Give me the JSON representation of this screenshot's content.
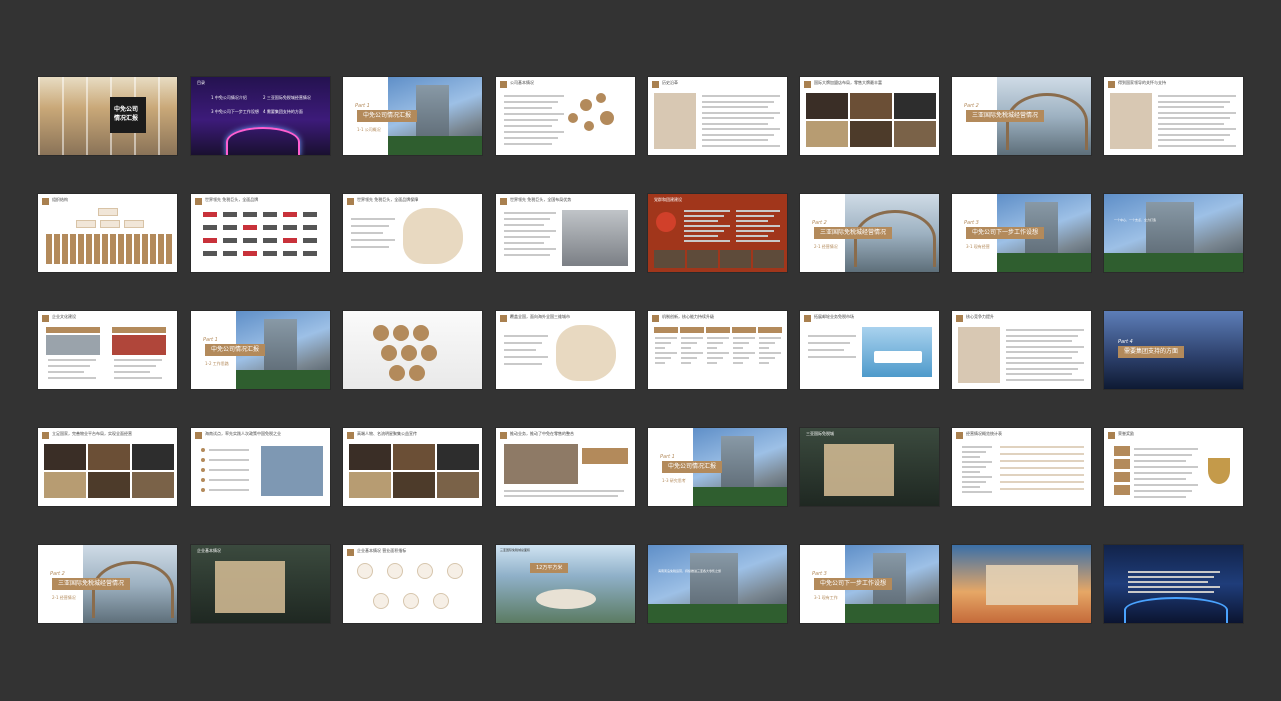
{
  "page": {
    "background": "#333333",
    "accent": "#b38a5b"
  },
  "slides": [
    {
      "kind": "cover",
      "title": "中免公司\n情况汇报"
    },
    {
      "kind": "toc",
      "header": "目录",
      "items": [
        "1  中免公司情况介绍",
        "2  三亚国际免税城经营情况",
        "3  中免公司下一步工作设想",
        "4  需要集团支持的方面"
      ]
    },
    {
      "kind": "part",
      "part": "Part 1",
      "title": "中免公司情况汇报",
      "sub": "1-1 公司概况"
    },
    {
      "kind": "bubbles",
      "header": "公司基本情况"
    },
    {
      "kind": "text",
      "header": "历史沿革"
    },
    {
      "kind": "photos",
      "header": "国际大牌加盟店布局，零售大牌最丰富"
    },
    {
      "kind": "part",
      "part": "Part 2",
      "title": "三亚国际免税城经营情况",
      "sub": ""
    },
    {
      "kind": "text",
      "header": "得到国家领导的关怀与支持"
    },
    {
      "kind": "diagram",
      "header": "组织结构"
    },
    {
      "kind": "logos",
      "header": "世界领先 免税巨头，全面品牌"
    },
    {
      "kind": "map",
      "header": "世界领先 免税巨头，全面品牌保障"
    },
    {
      "kind": "store",
      "header": "世界领先 免税巨头，全国布局优势"
    },
    {
      "kind": "red",
      "header": "党群和团建建设"
    },
    {
      "kind": "part",
      "part": "Part 2",
      "title": "三亚国际免税城经营情况",
      "sub": "2-1 经营情况"
    },
    {
      "kind": "part",
      "part": "Part 3",
      "title": "中免公司下一步工作设想",
      "sub": "3-1 现有经营"
    },
    {
      "kind": "building",
      "header": "一个中心、一个支点、全力打造"
    },
    {
      "kind": "twocol",
      "header": "企业文化建设"
    },
    {
      "kind": "part",
      "part": "Part 1",
      "title": "中免公司情况汇报",
      "sub": "1-2 工作思路"
    },
    {
      "kind": "bubbles2",
      "header": ""
    },
    {
      "kind": "map2",
      "header": "覆盖全国，面向海外全国三维城市"
    },
    {
      "kind": "columns",
      "header": "机制创新，核心能力持续升级"
    },
    {
      "kind": "ship",
      "header": "拓展邮轮业务免税市场"
    },
    {
      "kind": "list",
      "header": "核心竞争力提升"
    },
    {
      "kind": "night",
      "part": "Part 4",
      "title": "需要集团支持的方面"
    },
    {
      "kind": "photos2",
      "header": "立足国家，完善物业平台布局，实现全面经营"
    },
    {
      "kind": "timeline",
      "header": "海南试点，率先实践人次政策中国免税之业"
    },
    {
      "kind": "photos3",
      "header": "高端人物、名流明星聚集公益宣传"
    },
    {
      "kind": "event",
      "header": "推动业务，推动了中免在零售的整合"
    },
    {
      "kind": "part",
      "part": "Part 1",
      "title": "中免公司情况汇报",
      "sub": "1-3 研究思考"
    },
    {
      "kind": "dark",
      "header": "三亚国际免税城"
    },
    {
      "kind": "chart",
      "header": "经营情况概览统计表"
    },
    {
      "kind": "trophy",
      "header": "荣誉奖励"
    },
    {
      "kind": "part",
      "part": "Part 2",
      "title": "三亚国际免税城经营情况",
      "sub": "2-1 经营情况"
    },
    {
      "kind": "dark2",
      "header": "企业基本情况"
    },
    {
      "kind": "icons",
      "header": "企业基本情况  营业面积指标"
    },
    {
      "kind": "aerial",
      "header": "三亚国际免税城总面积",
      "big": "12万平方米"
    },
    {
      "kind": "building2",
      "header": "海南离岛免税运营，持续推进三亚各大零售之旅"
    },
    {
      "kind": "part",
      "part": "Part 3",
      "title": "中免公司下一步工作设想",
      "sub": "3-1 现有工作"
    },
    {
      "kind": "sunset",
      "header": ""
    },
    {
      "kind": "nightfinal",
      "header": ""
    }
  ]
}
